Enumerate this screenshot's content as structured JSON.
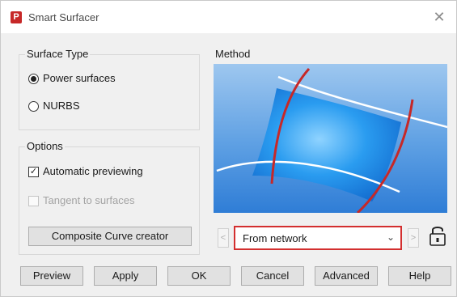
{
  "window": {
    "title": "Smart Surfacer",
    "app_icon_glyph": "P",
    "close_glyph": "✕"
  },
  "surface_type": {
    "label": "Surface Type",
    "options": [
      {
        "label": "Power surfaces",
        "checked": true
      },
      {
        "label": "NURBS",
        "checked": false
      }
    ]
  },
  "options": {
    "label": "Options",
    "automatic_previewing": {
      "label": "Automatic previewing",
      "checked": true
    },
    "tangent_to_surfaces": {
      "label": "Tangent to surfaces",
      "checked": false,
      "enabled": false
    },
    "composite_button": "Composite Curve creator"
  },
  "method": {
    "label": "Method",
    "selected": "From network",
    "prev_arrow": "<",
    "next_arrow": ">"
  },
  "buttons": {
    "preview": "Preview",
    "apply": "Apply",
    "ok": "OK",
    "cancel": "Cancel",
    "advanced": "Advanced",
    "help": "Help"
  },
  "colors": {
    "highlight_border": "#d32f2f",
    "surface_blue": "#1e88e5",
    "curve_red": "#c62828"
  }
}
